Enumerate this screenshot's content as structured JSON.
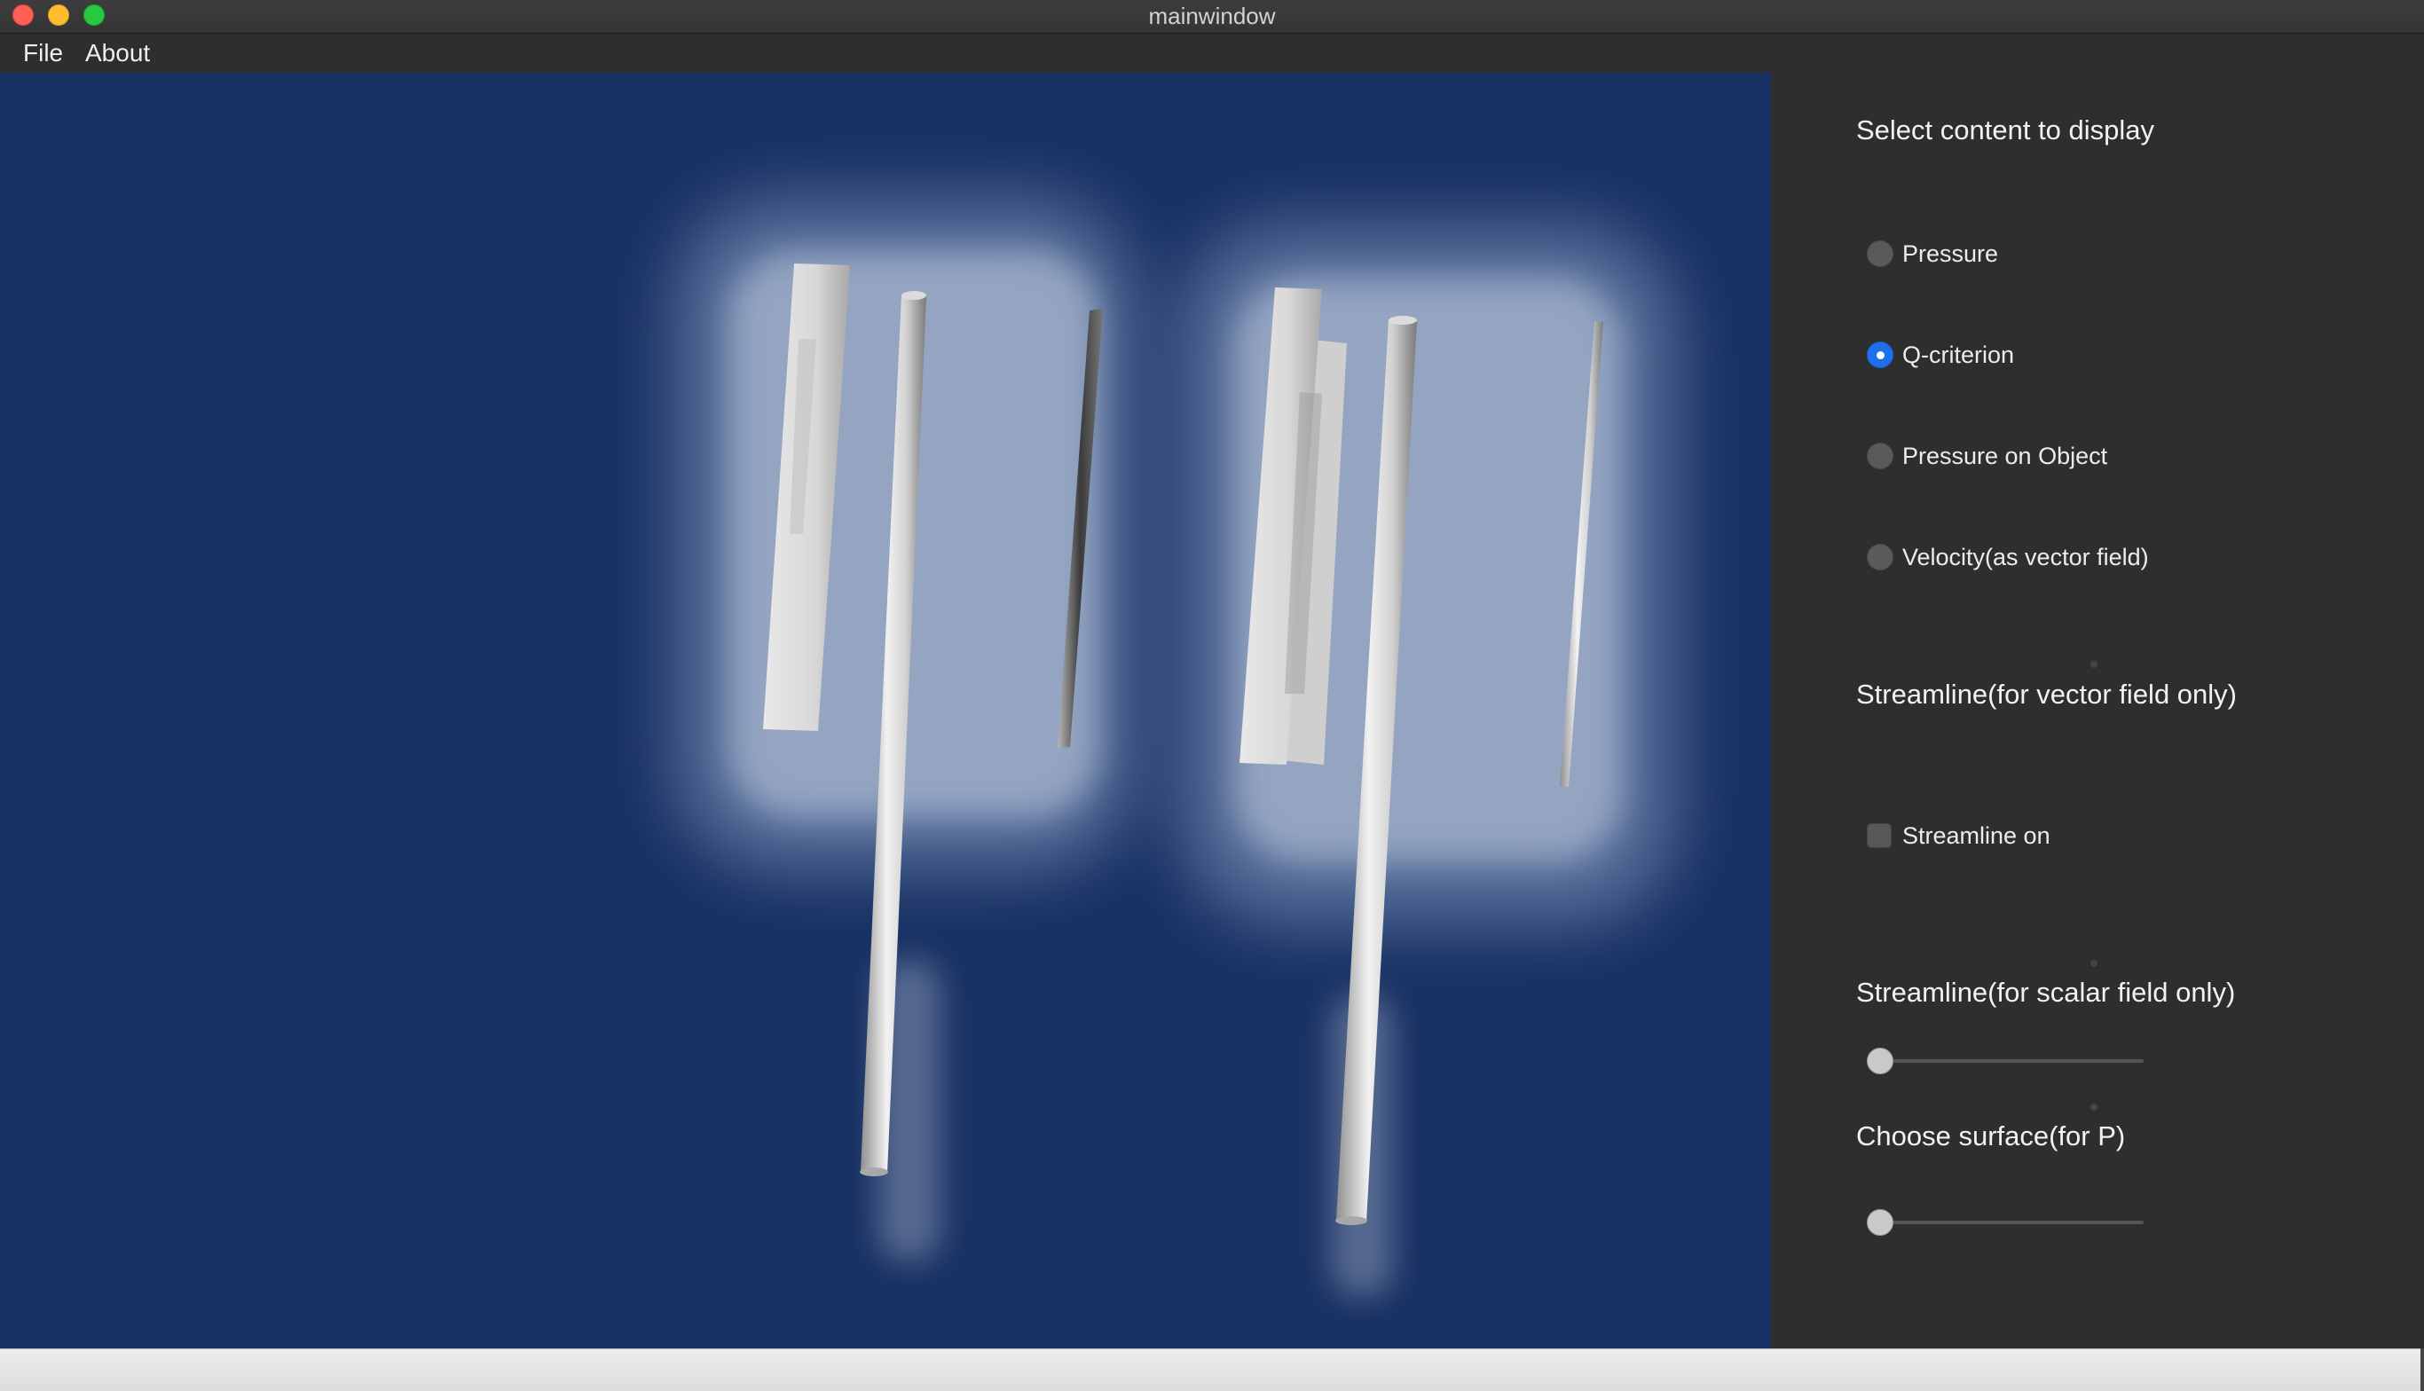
{
  "window": {
    "title": "mainwindow"
  },
  "menu": {
    "file": "File",
    "about": "About"
  },
  "colors": {
    "viewport_bg": "#183163",
    "panel_bg": "#2e2e2e",
    "accent": "#1f6feb"
  },
  "panel": {
    "heading_select": "Select content to display",
    "radios": [
      {
        "label": "Pressure",
        "selected": false
      },
      {
        "label": "Q-criterion",
        "selected": true
      },
      {
        "label": "Pressure on Object",
        "selected": false
      },
      {
        "label": "Velocity(as vector field)",
        "selected": false
      }
    ],
    "heading_streamline_vector": "Streamline(for vector field only)",
    "streamline_checkbox": {
      "label": "Streamline on",
      "checked": false
    },
    "heading_streamline_scalar": "Streamline(for scalar field only)",
    "slider_scalar": {
      "value": 0
    },
    "heading_surface": "Choose surface(for P)",
    "slider_surface": {
      "value": 0
    }
  }
}
